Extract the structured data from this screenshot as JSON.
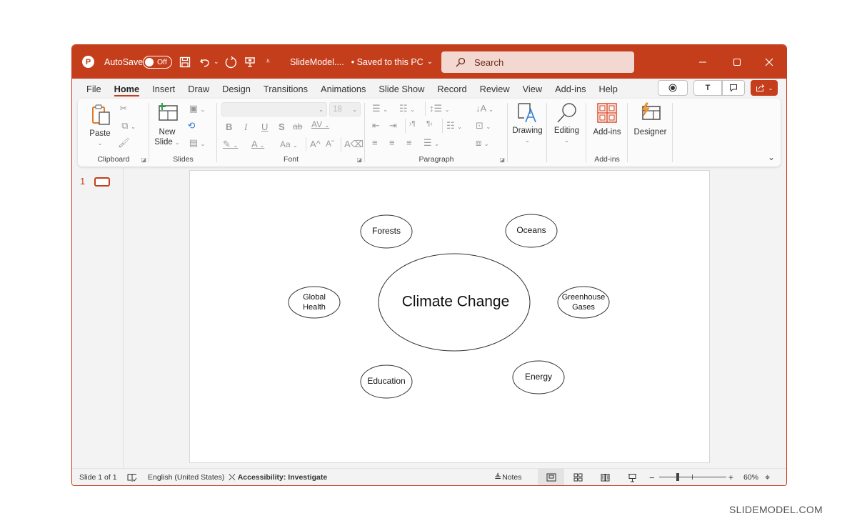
{
  "titlebar": {
    "autosave_label": "AutoSave",
    "autosave_state": "Off",
    "document_title": "SlideModel....",
    "save_status": "• Saved to this PC",
    "search_placeholder": "Search"
  },
  "menu": {
    "tabs": [
      "File",
      "Home",
      "Insert",
      "Draw",
      "Design",
      "Transitions",
      "Animations",
      "Slide Show",
      "Record",
      "Review",
      "View",
      "Add-ins",
      "Help"
    ],
    "active_tab": "Home"
  },
  "ribbon": {
    "clipboard": {
      "paste_label": "Paste",
      "group_label": "Clipboard"
    },
    "slides": {
      "new_slide_line1": "New",
      "new_slide_line2": "Slide",
      "group_label": "Slides"
    },
    "font": {
      "font_name": "",
      "font_size": "18",
      "group_label": "Font",
      "bold": "B",
      "italic": "I",
      "underline": "U",
      "shadow": "S",
      "strikethrough": "ab",
      "spacing": "AV",
      "case": "Aa",
      "grow": "A^",
      "shrink": "Aˇ"
    },
    "paragraph": {
      "group_label": "Paragraph"
    },
    "drawing": {
      "label": "Drawing"
    },
    "editing": {
      "label": "Editing"
    },
    "addins": {
      "label": "Add-ins",
      "group_label": "Add-ins"
    },
    "designer": {
      "label": "Designer"
    }
  },
  "thumbnails": {
    "slide_number": "1"
  },
  "slide": {
    "center": "Climate Change",
    "nodes": [
      {
        "label": [
          "Forests"
        ]
      },
      {
        "label": [
          "Oceans"
        ]
      },
      {
        "label": [
          "Global",
          "Health"
        ]
      },
      {
        "label": [
          "Greenhouse",
          "Gases"
        ]
      },
      {
        "label": [
          "Education"
        ]
      },
      {
        "label": [
          "Energy"
        ]
      }
    ]
  },
  "statusbar": {
    "slide_info": "Slide 1 of 1",
    "language": "English (United States)",
    "accessibility": "Accessibility: Investigate",
    "notes_label": "Notes",
    "zoom_level": "60%",
    "zoom_percent": 60
  },
  "branding": {
    "watermark": "SLIDEMODEL.COM"
  },
  "colors": {
    "accent": "#c43e1c",
    "search_bg": "#f2d8d1"
  }
}
